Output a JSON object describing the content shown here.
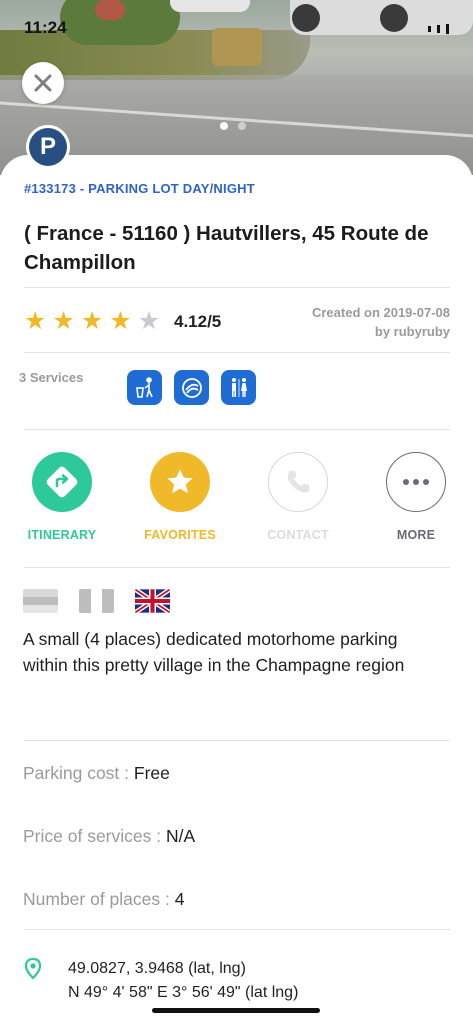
{
  "status_bar": {
    "time": "11:24"
  },
  "category": "#133173 - PARKING LOT DAY/NIGHT",
  "badge_letter": "P",
  "title": "( France - 51160 ) Hautvillers, 45 Route de Champillon",
  "rating": {
    "value": 4.12,
    "text": "4.12/5",
    "stars_filled": 4,
    "stars_total": 5
  },
  "created": {
    "line1": "Created on 2019-07-08",
    "line2": "by rubyruby"
  },
  "services": {
    "label": "3 Services",
    "icons": [
      "trash-disposal-icon",
      "water-drain-icon",
      "toilets-icon"
    ]
  },
  "actions": [
    {
      "label": "ITINERARY",
      "icon": "directions-icon",
      "color": "#2ec99a",
      "enabled": true
    },
    {
      "label": "FAVORITES",
      "icon": "star-icon",
      "color": "#f0b92a",
      "enabled": true
    },
    {
      "label": "CONTACT",
      "icon": "phone-icon",
      "color": "#d7d7d7",
      "enabled": false
    },
    {
      "label": "MORE",
      "icon": "more-icon",
      "color": "#6a6a7a",
      "enabled": true
    }
  ],
  "languages": [
    "de",
    "fr",
    "en"
  ],
  "description": "A small (4 places) dedicated motorhome parking within this pretty village in the Champagne region",
  "info": {
    "parking_cost": {
      "label": "Parking cost : ",
      "value": "Free"
    },
    "price_services": {
      "label": "Price of services : ",
      "value": "N/A"
    },
    "places": {
      "label": "Number of places : ",
      "value": "4"
    }
  },
  "coordinates": {
    "decimal": "49.0827, 3.9468 (lat, lng)",
    "dms": "N 49° 4' 58\" E 3° 56' 49\" (lat lng)"
  },
  "colors": {
    "accent_blue": "#2e63c8",
    "star": "#f0b92a",
    "green": "#2ec99a"
  }
}
